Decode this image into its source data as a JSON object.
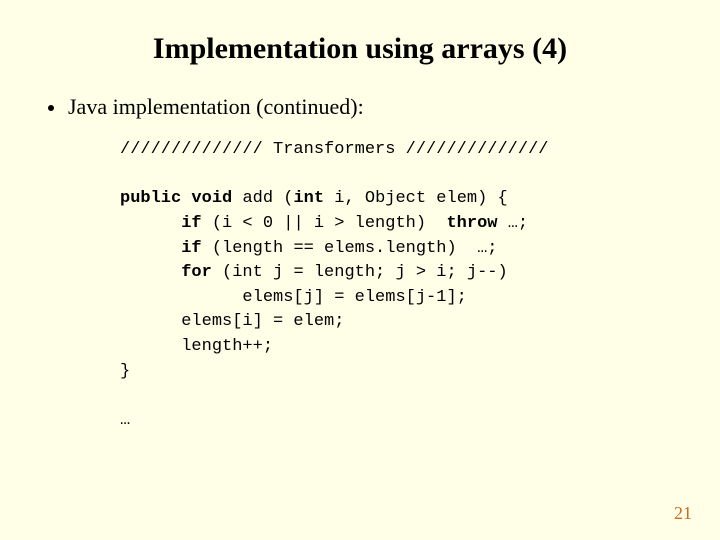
{
  "title": "Implementation using arrays (4)",
  "bullet": "Java implementation (continued):",
  "code": {
    "comment_left": "//////////////",
    "comment_label": "Transformers",
    "comment_right": "//////////////",
    "kw_public": "public",
    "kw_void": "void",
    "fn_name": "add",
    "kw_int": "int",
    "param_i": "i",
    "param_obj_type": "Object",
    "param_obj": "elem",
    "open_brace": "{",
    "kw_if1": "if",
    "cond1": "(i < 0 || i > length)",
    "kw_throw": "throw",
    "ellipsis1": "…;",
    "kw_if2": "if",
    "cond2": "(length == elems.length)",
    "ellipsis2": "…;",
    "kw_for": "for",
    "for_head": "(int j = length; j > i; j--)",
    "for_body": "elems[j] = elems[j-1];",
    "assign1": "elems[i] = elem;",
    "assign2": "length++;",
    "close_brace": "}",
    "trailing": "…"
  },
  "page_number": "21"
}
